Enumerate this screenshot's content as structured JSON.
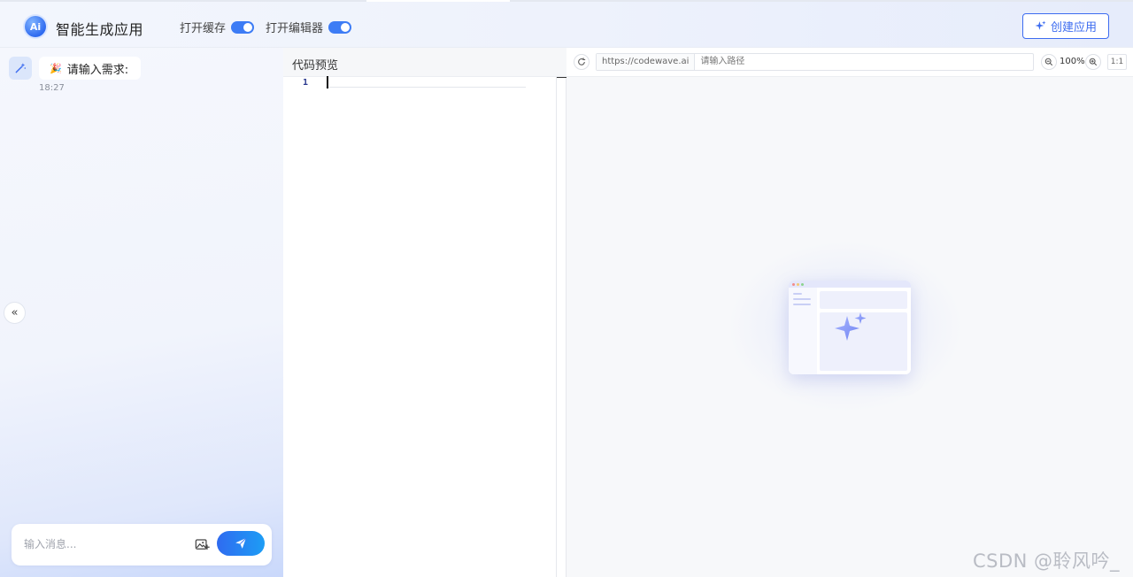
{
  "header": {
    "app_title": "智能生成应用",
    "logo_text": "Ai",
    "toggles": [
      {
        "label": "打开缓存",
        "on": true
      },
      {
        "label": "打开编辑器",
        "on": true
      }
    ],
    "create_button_label": "创建应用"
  },
  "chat": {
    "message": {
      "emoji": "🎉",
      "text": "请输入需求:",
      "time": "18:27"
    },
    "collapse_glyph": "«",
    "input_placeholder": "输入消息..."
  },
  "code_preview": {
    "title": "代码预览",
    "line_numbers": [
      "1"
    ]
  },
  "preview": {
    "url_base": "https://codewave.ai",
    "path_placeholder": "请输入路径",
    "zoom_value": "100%",
    "ratio_label": "1:1"
  },
  "watermark": "CSDN @聆风吟_",
  "colors": {
    "accent": "#3d6cf0",
    "switch_on": "#3d7cf5",
    "send_gradient_start": "#2f6bf0",
    "send_gradient_end": "#1d9df5"
  }
}
